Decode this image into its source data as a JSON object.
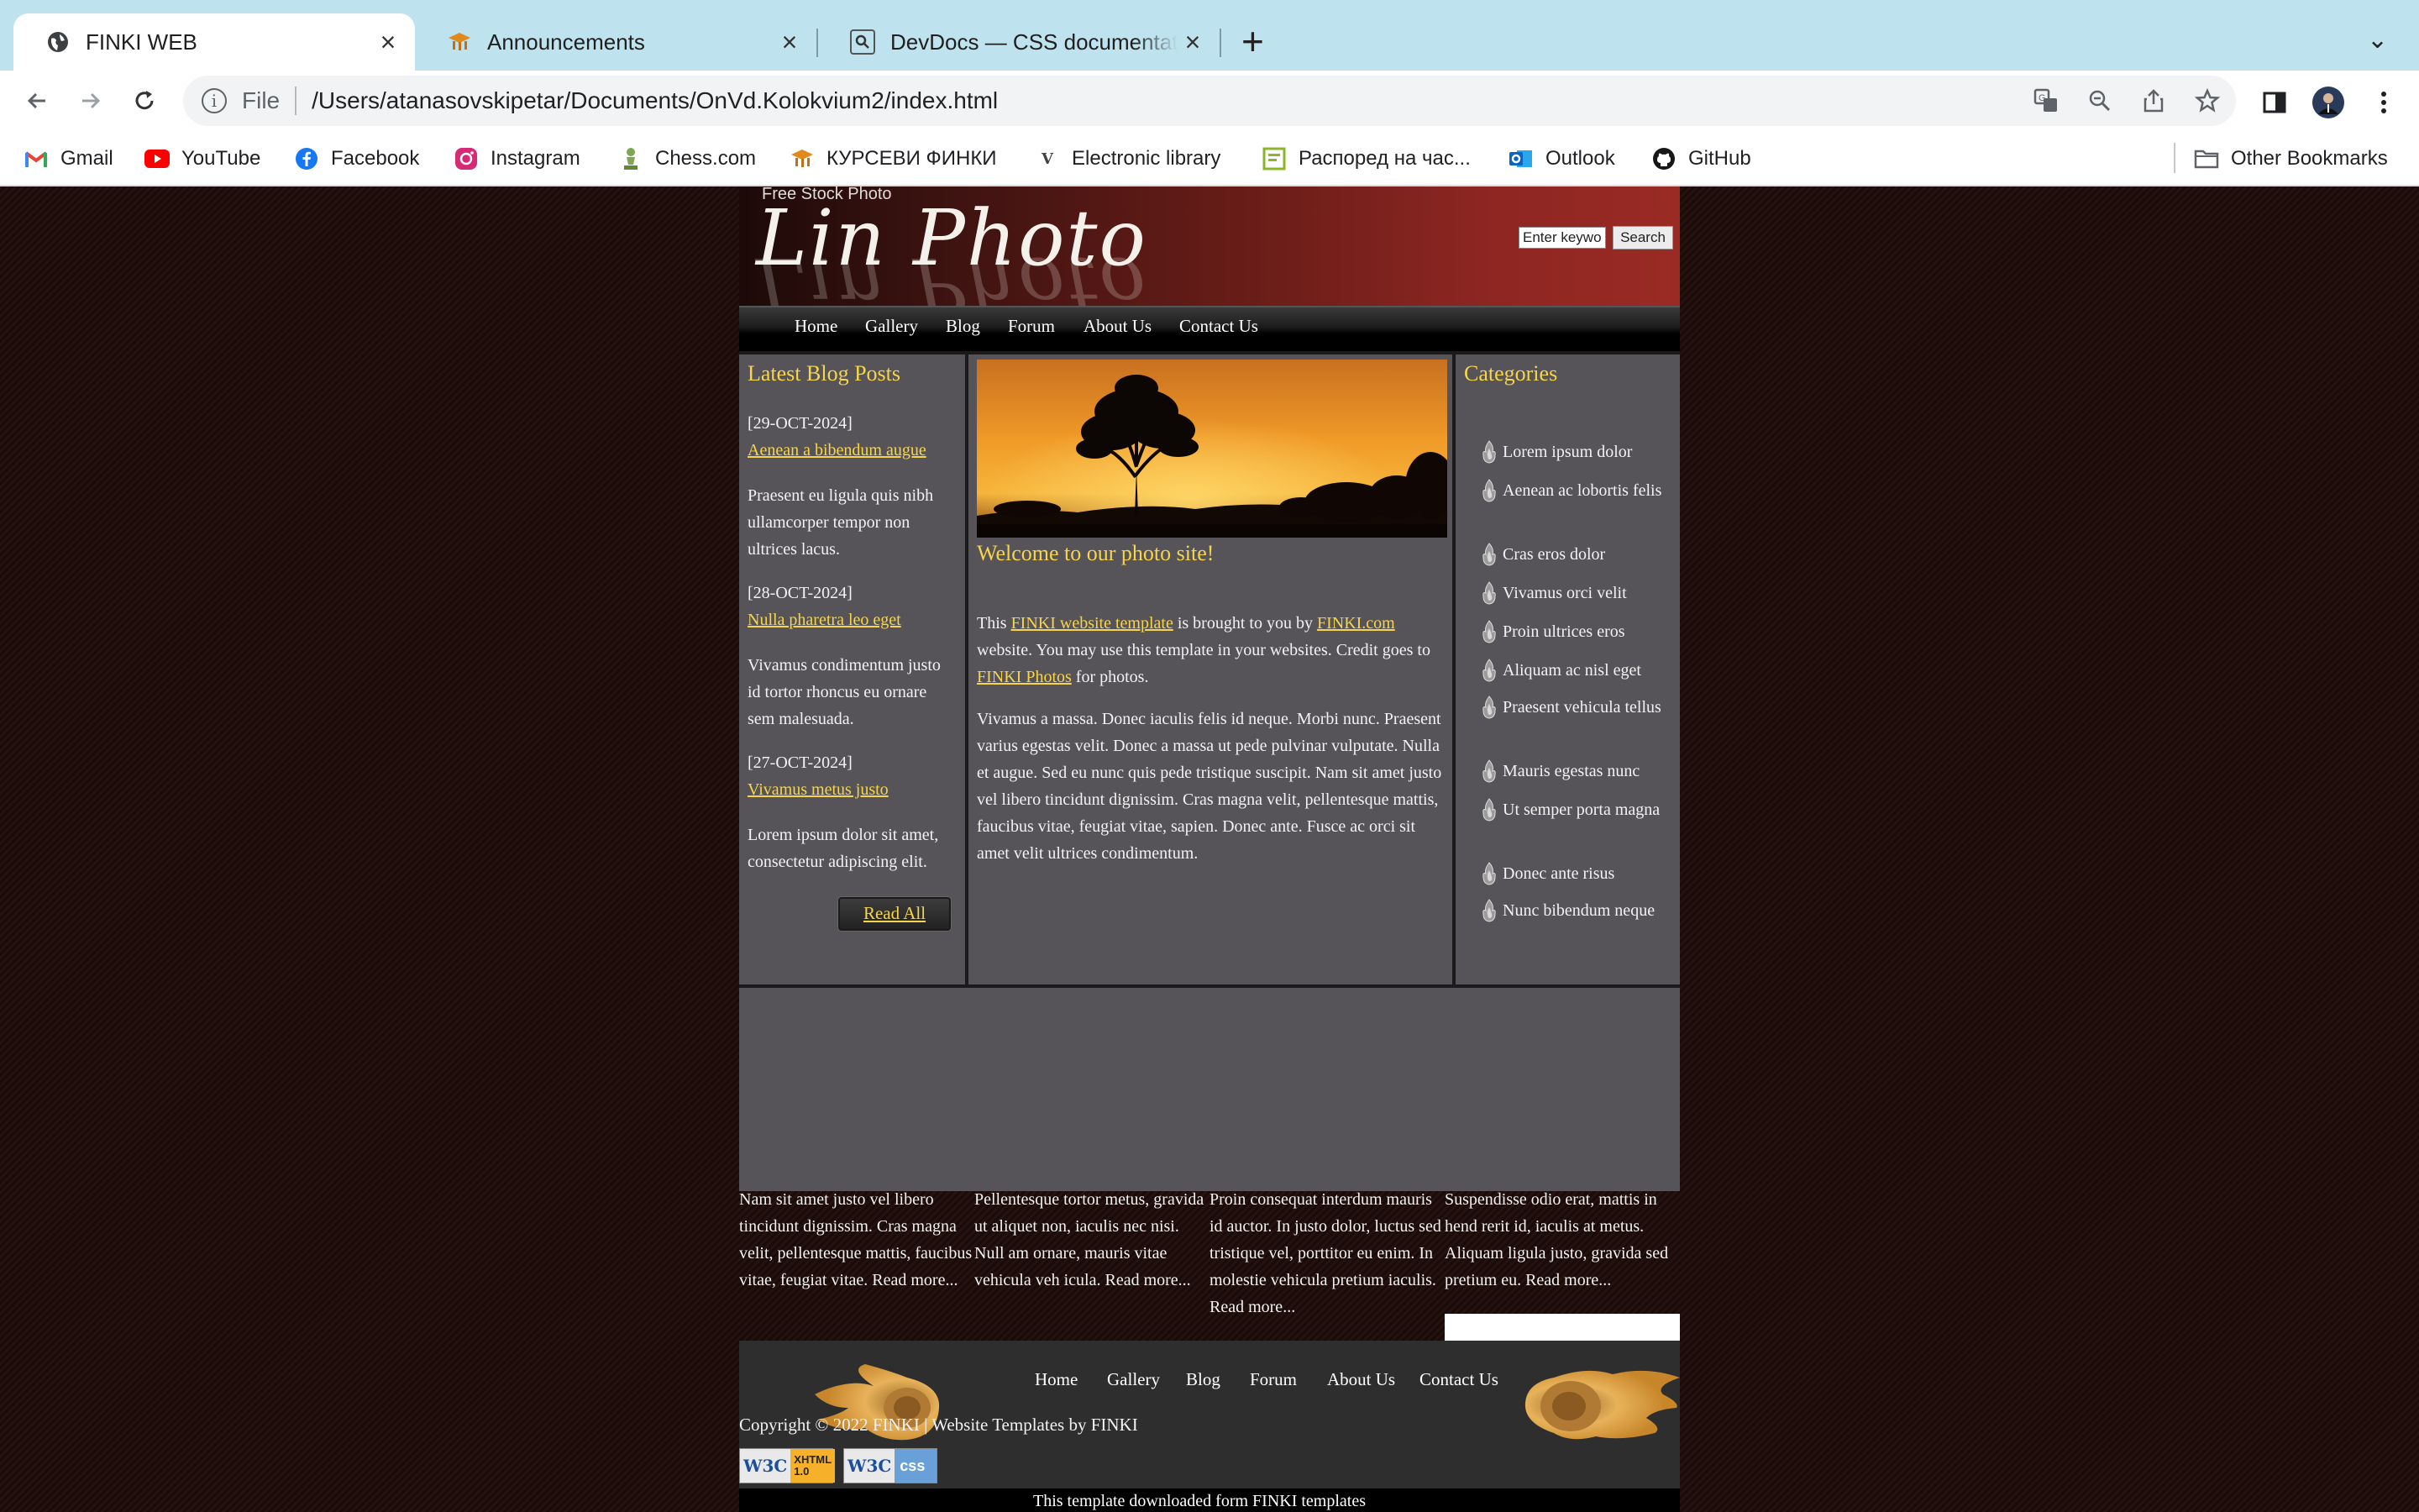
{
  "browser": {
    "tabs": [
      {
        "title": "FINKI WEB",
        "active": true,
        "icon": "globe-icon"
      },
      {
        "title": "Announcements",
        "active": false,
        "icon": "finki-icon"
      },
      {
        "title": "DevDocs — CSS documentation",
        "active": false,
        "icon": "devdocs-icon"
      }
    ],
    "address": {
      "scheme": "File",
      "url": "/Users/atanasovskipetar/Documents/OnVd.Kolokvium2/index.html"
    },
    "bookmarks": [
      {
        "label": "Gmail",
        "icon": "gmail-icon"
      },
      {
        "label": "YouTube",
        "icon": "youtube-icon"
      },
      {
        "label": "Facebook",
        "icon": "facebook-icon"
      },
      {
        "label": "Instagram",
        "icon": "instagram-icon"
      },
      {
        "label": "Chess.com",
        "icon": "chess-icon"
      },
      {
        "label": "КУРСЕВИ ФИНКИ",
        "icon": "finki-icon"
      },
      {
        "label": "Electronic library",
        "icon": "library-icon"
      },
      {
        "label": "Распоред на час...",
        "icon": "schedule-icon"
      },
      {
        "label": "Outlook",
        "icon": "outlook-icon"
      },
      {
        "label": "GitHub",
        "icon": "github-icon"
      }
    ],
    "other_bookmarks": "Other Bookmarks"
  },
  "site": {
    "tagline": "Free Stock Photo",
    "logo": "Lin Photo",
    "search": {
      "value": "Enter keywo",
      "button": "Search"
    },
    "nav": [
      "Home",
      "Gallery",
      "Blog",
      "Forum",
      "About Us",
      "Contact Us"
    ],
    "blog": {
      "heading": "Latest Blog Posts",
      "posts": [
        {
          "date": "[29-OCT-2024]",
          "title": "Aenean a bibendum augue",
          "text": "Praesent eu ligula quis nibh ullamcorper tempor non ultrices lacus."
        },
        {
          "date": "[28-OCT-2024]",
          "title": "Nulla pharetra leo eget",
          "text": "Vivamus condimentum justo id tortor rhoncus eu ornare sem malesuada."
        },
        {
          "date": "[27-OCT-2024]",
          "title": "Vivamus metus justo",
          "text": "Lorem ipsum dolor sit amet, consectetur adipiscing elit."
        }
      ],
      "read_all": "Read All"
    },
    "main": {
      "heading": "Welcome to our photo site!",
      "intro": {
        "t1": "This ",
        "link1": "FINKI website template",
        "t2": " is brought to you by ",
        "link2": "FINKI.com",
        "t3": " website. You may use this template in your websites. Credit goes to ",
        "link3": "FINKI Photos",
        "t4": " for photos."
      },
      "body": "Vivamus a massa. Donec iaculis felis id neque. Morbi nunc. Praesent varius egestas velit. Donec a massa ut pede pulvinar vulputate. Nulla et augue. Sed eu nunc quis pede tristique suscipit. Nam sit amet justo vel libero tincidunt dignissim. Cras magna velit, pellentesque mattis, faucibus vitae, feugiat vitae, sapien. Donec ante. Fusce ac orci sit amet velit ultrices condimentum."
    },
    "categories": {
      "heading": "Categories",
      "items": [
        "Lorem ipsum dolor",
        "Aenean ac lobortis felis",
        "Cras eros dolor",
        "Vivamus orci velit",
        "Proin ultrices eros",
        "Aliquam ac nisl eget",
        "Praesent vehicula tellus",
        "Mauris egestas nunc",
        "Ut semper porta magna",
        "Donec ante risus",
        "Nunc bibendum neque"
      ]
    },
    "bottom": [
      "Nam sit amet justo vel libero tincidunt dignissim. Cras magna velit, pellentesque mattis, faucibus vitae, feugiat vitae. Read more...",
      "Pellentesque tortor metus, gravida ut aliquet non, iaculis nec nisi. Null am ornare, mauris vitae vehicula veh icula. Read more...",
      "Proin consequat interdum mauris id auctor. In justo dolor, luctus sed tristique vel, porttitor eu enim. In molestie vehicula pretium iaculis. Read more...",
      "Suspendisse odio erat, mattis in hend rerit id, iaculis at metus. Aliquam ligula justo, gravida sed pretium eu. Read more..."
    ],
    "footer": {
      "nav": [
        "Home",
        "Gallery",
        "Blog",
        "Forum",
        "About Us",
        "Contact Us"
      ],
      "copyright": "Copyright © 2022 FINKI | Website Templates by FINKI",
      "badges": [
        {
          "w3c": "W3C",
          "label": "XHTML 1.0"
        },
        {
          "w3c": "W3C",
          "label": "css"
        }
      ],
      "downloaded": "This template downloaded form FINKI templates"
    },
    "colors": {
      "accent": "#f7d54a",
      "panel": "#565458",
      "header_red": "#8e2622"
    }
  }
}
